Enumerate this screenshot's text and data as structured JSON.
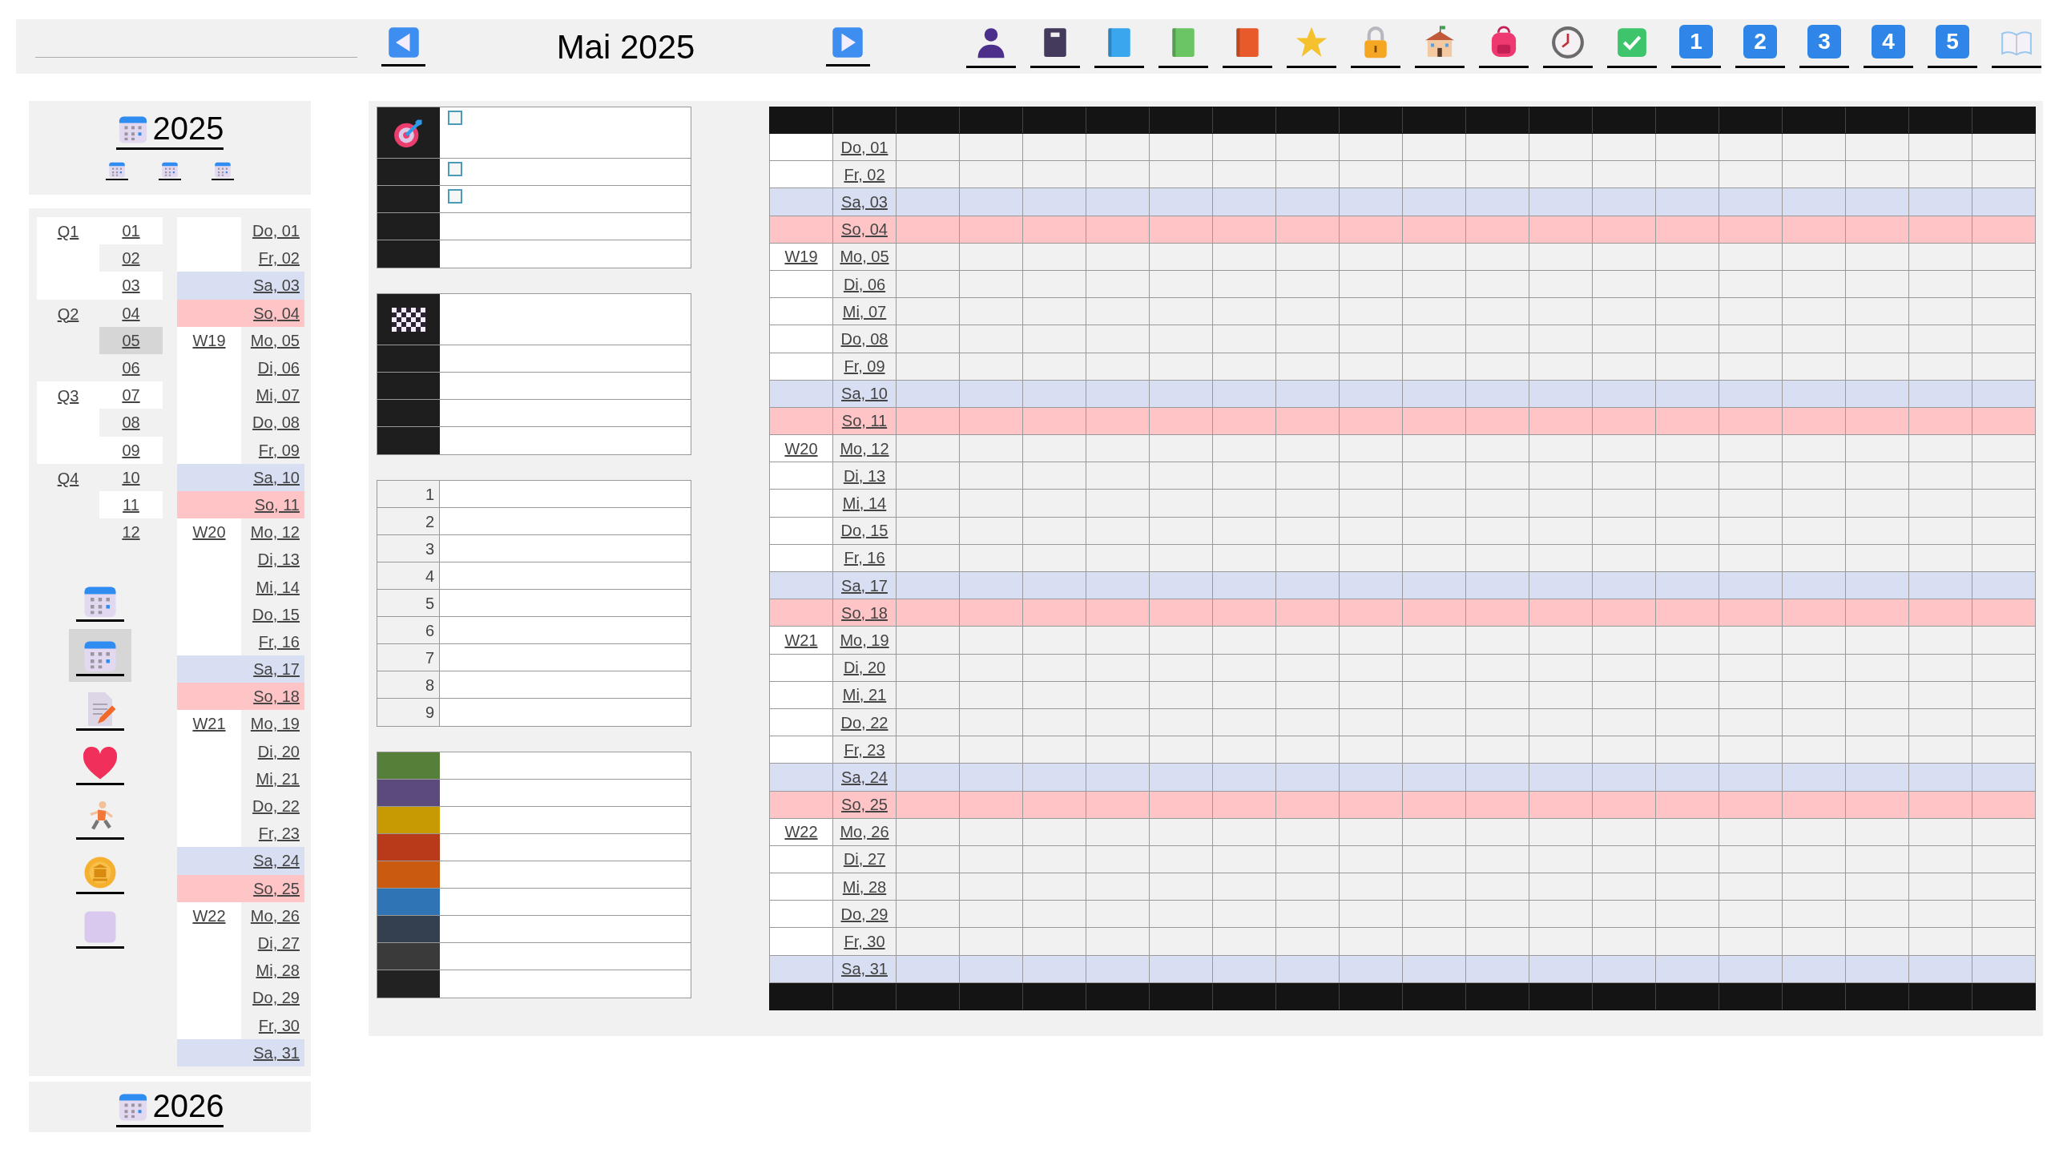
{
  "header": {
    "title": "Mai 2025"
  },
  "toolbar": [
    {
      "kind": "person"
    },
    {
      "kind": "notebook"
    },
    {
      "kind": "book",
      "color": "#3aa6ee"
    },
    {
      "kind": "book",
      "color": "#6cc565"
    },
    {
      "kind": "book",
      "color": "#e85a2a"
    },
    {
      "kind": "star"
    },
    {
      "kind": "lock"
    },
    {
      "kind": "school"
    },
    {
      "kind": "backpack"
    },
    {
      "kind": "clock"
    },
    {
      "kind": "check"
    },
    {
      "kind": "number",
      "label": "1"
    },
    {
      "kind": "number",
      "label": "2"
    },
    {
      "kind": "number",
      "label": "3"
    },
    {
      "kind": "number",
      "label": "4"
    },
    {
      "kind": "number",
      "label": "5"
    },
    {
      "kind": "open-book"
    }
  ],
  "sidebar": {
    "year": "2025",
    "next_year": "2026",
    "quarters": [
      {
        "label": "Q1"
      },
      {
        "label": "Q2"
      },
      {
        "label": "Q3"
      },
      {
        "label": "Q4"
      }
    ],
    "months": [
      {
        "label": "01",
        "selected": false
      },
      {
        "label": "02",
        "selected": false
      },
      {
        "label": "03",
        "selected": false
      },
      {
        "label": "04",
        "selected": false
      },
      {
        "label": "05",
        "selected": true
      },
      {
        "label": "06",
        "selected": false
      },
      {
        "label": "07",
        "selected": false
      },
      {
        "label": "08",
        "selected": false
      },
      {
        "label": "09",
        "selected": false
      },
      {
        "label": "10",
        "selected": false
      },
      {
        "label": "11",
        "selected": false
      },
      {
        "label": "12",
        "selected": false
      }
    ],
    "tools": [
      {
        "kind": "calendar",
        "selected": false
      },
      {
        "kind": "calendar",
        "selected": true
      },
      {
        "kind": "document",
        "selected": false
      },
      {
        "kind": "heart",
        "selected": false
      },
      {
        "kind": "runner",
        "selected": false
      },
      {
        "kind": "coin",
        "selected": false
      },
      {
        "kind": "square",
        "selected": false
      }
    ],
    "days": [
      {
        "label": "Do, 01",
        "kind": "weekday"
      },
      {
        "label": "Fr, 02",
        "kind": "weekday"
      },
      {
        "label": "Sa, 03",
        "kind": "saturday"
      },
      {
        "label": "So, 04",
        "kind": "sunday"
      },
      {
        "week": "W19",
        "label": "Mo, 05",
        "kind": "weekday"
      },
      {
        "label": "Di, 06",
        "kind": "weekday"
      },
      {
        "label": "Mi, 07",
        "kind": "weekday"
      },
      {
        "label": "Do, 08",
        "kind": "weekday"
      },
      {
        "label": "Fr, 09",
        "kind": "weekday"
      },
      {
        "label": "Sa, 10",
        "kind": "saturday"
      },
      {
        "label": "So, 11",
        "kind": "sunday"
      },
      {
        "week": "W20",
        "label": "Mo, 12",
        "kind": "weekday"
      },
      {
        "label": "Di, 13",
        "kind": "weekday"
      },
      {
        "label": "Mi, 14",
        "kind": "weekday"
      },
      {
        "label": "Do, 15",
        "kind": "weekday"
      },
      {
        "label": "Fr, 16",
        "kind": "weekday"
      },
      {
        "label": "Sa, 17",
        "kind": "saturday"
      },
      {
        "label": "So, 18",
        "kind": "sunday"
      },
      {
        "week": "W21",
        "label": "Mo, 19",
        "kind": "weekday"
      },
      {
        "label": "Di, 20",
        "kind": "weekday"
      },
      {
        "label": "Mi, 21",
        "kind": "weekday"
      },
      {
        "label": "Do, 22",
        "kind": "weekday"
      },
      {
        "label": "Fr, 23",
        "kind": "weekday"
      },
      {
        "label": "Sa, 24",
        "kind": "saturday"
      },
      {
        "label": "So, 25",
        "kind": "sunday"
      },
      {
        "week": "W22",
        "label": "Mo, 26",
        "kind": "weekday"
      },
      {
        "label": "Di, 27",
        "kind": "weekday"
      },
      {
        "label": "Mi, 28",
        "kind": "weekday"
      },
      {
        "label": "Do, 29",
        "kind": "weekday"
      },
      {
        "label": "Fr, 30",
        "kind": "weekday"
      },
      {
        "label": "Sa, 31",
        "kind": "saturday"
      }
    ]
  },
  "goals": {
    "checkboxes": [
      {
        "checked": false
      },
      {
        "checked": false
      },
      {
        "checked": false
      }
    ]
  },
  "numbered": [
    {
      "label": "1"
    },
    {
      "label": "2"
    },
    {
      "label": "3"
    },
    {
      "label": "4"
    },
    {
      "label": "5"
    },
    {
      "label": "6"
    },
    {
      "label": "7"
    },
    {
      "label": "8"
    },
    {
      "label": "9"
    }
  ],
  "colors": [
    {
      "color": "#56803a"
    },
    {
      "color": "#5b4a7c"
    },
    {
      "color": "#c79a03"
    },
    {
      "color": "#b83a1a"
    },
    {
      "color": "#c95a10"
    },
    {
      "color": "#2f74b5"
    },
    {
      "color": "#344050"
    },
    {
      "color": "#3a3a3a"
    },
    {
      "color": "#222222"
    }
  ],
  "grid": {
    "rows": [
      {
        "label": "Do, 01",
        "kind": "weekday"
      },
      {
        "label": "Fr, 02",
        "kind": "weekday"
      },
      {
        "label": "Sa, 03",
        "kind": "saturday"
      },
      {
        "label": "So, 04",
        "kind": "sunday"
      },
      {
        "week": "W19",
        "label": "Mo, 05",
        "kind": "weekday"
      },
      {
        "label": "Di, 06",
        "kind": "weekday"
      },
      {
        "label": "Mi, 07",
        "kind": "weekday"
      },
      {
        "label": "Do, 08",
        "kind": "weekday"
      },
      {
        "label": "Fr, 09",
        "kind": "weekday"
      },
      {
        "label": "Sa, 10",
        "kind": "saturday"
      },
      {
        "label": "So, 11",
        "kind": "sunday"
      },
      {
        "week": "W20",
        "label": "Mo, 12",
        "kind": "weekday"
      },
      {
        "label": "Di, 13",
        "kind": "weekday"
      },
      {
        "label": "Mi, 14",
        "kind": "weekday"
      },
      {
        "label": "Do, 15",
        "kind": "weekday"
      },
      {
        "label": "Fr, 16",
        "kind": "weekday"
      },
      {
        "label": "Sa, 17",
        "kind": "saturday"
      },
      {
        "label": "So, 18",
        "kind": "sunday"
      },
      {
        "week": "W21",
        "label": "Mo, 19",
        "kind": "weekday"
      },
      {
        "label": "Di, 20",
        "kind": "weekday"
      },
      {
        "label": "Mi, 21",
        "kind": "weekday"
      },
      {
        "label": "Do, 22",
        "kind": "weekday"
      },
      {
        "label": "Fr, 23",
        "kind": "weekday"
      },
      {
        "label": "Sa, 24",
        "kind": "saturday"
      },
      {
        "label": "So, 25",
        "kind": "sunday"
      },
      {
        "week": "W22",
        "label": "Mo, 26",
        "kind": "weekday"
      },
      {
        "label": "Di, 27",
        "kind": "weekday"
      },
      {
        "label": "Mi, 28",
        "kind": "weekday"
      },
      {
        "label": "Do, 29",
        "kind": "weekday"
      },
      {
        "label": "Fr, 30",
        "kind": "weekday"
      },
      {
        "label": "Sa, 31",
        "kind": "saturday"
      }
    ]
  }
}
